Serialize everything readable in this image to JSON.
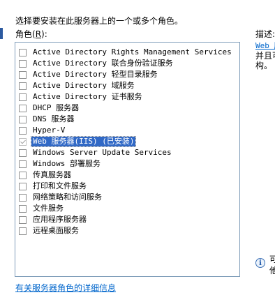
{
  "instruction": "选择要安装在此服务器上的一个或多个角色。",
  "roles_label_prefix": "角色(",
  "roles_label_accel": "R",
  "roles_label_suffix": "):",
  "roles": [
    {
      "label": "Active Directory Rights Management Services",
      "checked": false,
      "disabled": false,
      "selected": false
    },
    {
      "label": "Active Directory 联合身份验证服务",
      "checked": false,
      "disabled": false,
      "selected": false
    },
    {
      "label": "Active Directory 轻型目录服务",
      "checked": false,
      "disabled": false,
      "selected": false
    },
    {
      "label": "Active Directory 域服务",
      "checked": false,
      "disabled": false,
      "selected": false
    },
    {
      "label": "Active Directory 证书服务",
      "checked": false,
      "disabled": false,
      "selected": false
    },
    {
      "label": "DHCP 服务器",
      "checked": false,
      "disabled": false,
      "selected": false
    },
    {
      "label": "DNS 服务器",
      "checked": false,
      "disabled": false,
      "selected": false
    },
    {
      "label": "Hyper-V",
      "checked": false,
      "disabled": false,
      "selected": false
    },
    {
      "label": "Web 服务器(IIS) (已安装)",
      "checked": true,
      "disabled": true,
      "selected": true
    },
    {
      "label": "Windows Server Update Services",
      "checked": false,
      "disabled": false,
      "selected": false
    },
    {
      "label": "Windows 部署服务",
      "checked": false,
      "disabled": false,
      "selected": false
    },
    {
      "label": "传真服务器",
      "checked": false,
      "disabled": false,
      "selected": false
    },
    {
      "label": "打印和文件服务",
      "checked": false,
      "disabled": false,
      "selected": false
    },
    {
      "label": "网络策略和访问服务",
      "checked": false,
      "disabled": false,
      "selected": false
    },
    {
      "label": "文件服务",
      "checked": false,
      "disabled": false,
      "selected": false
    },
    {
      "label": "应用程序服务器",
      "checked": false,
      "disabled": false,
      "selected": false
    },
    {
      "label": "远程桌面服务",
      "checked": false,
      "disabled": false,
      "selected": false
    }
  ],
  "description": {
    "label": "描述:",
    "link_text": "Web 服",
    "line2": "并且可",
    "line3": "构。"
  },
  "info": {
    "icon": "info-icon",
    "line1": "可",
    "line2": "他"
  },
  "more_info_link": "有关服务器角色的详细信息",
  "colors": {
    "selection": "#3169c6",
    "link": "#0066cc",
    "list_border": "#7f9db9"
  }
}
